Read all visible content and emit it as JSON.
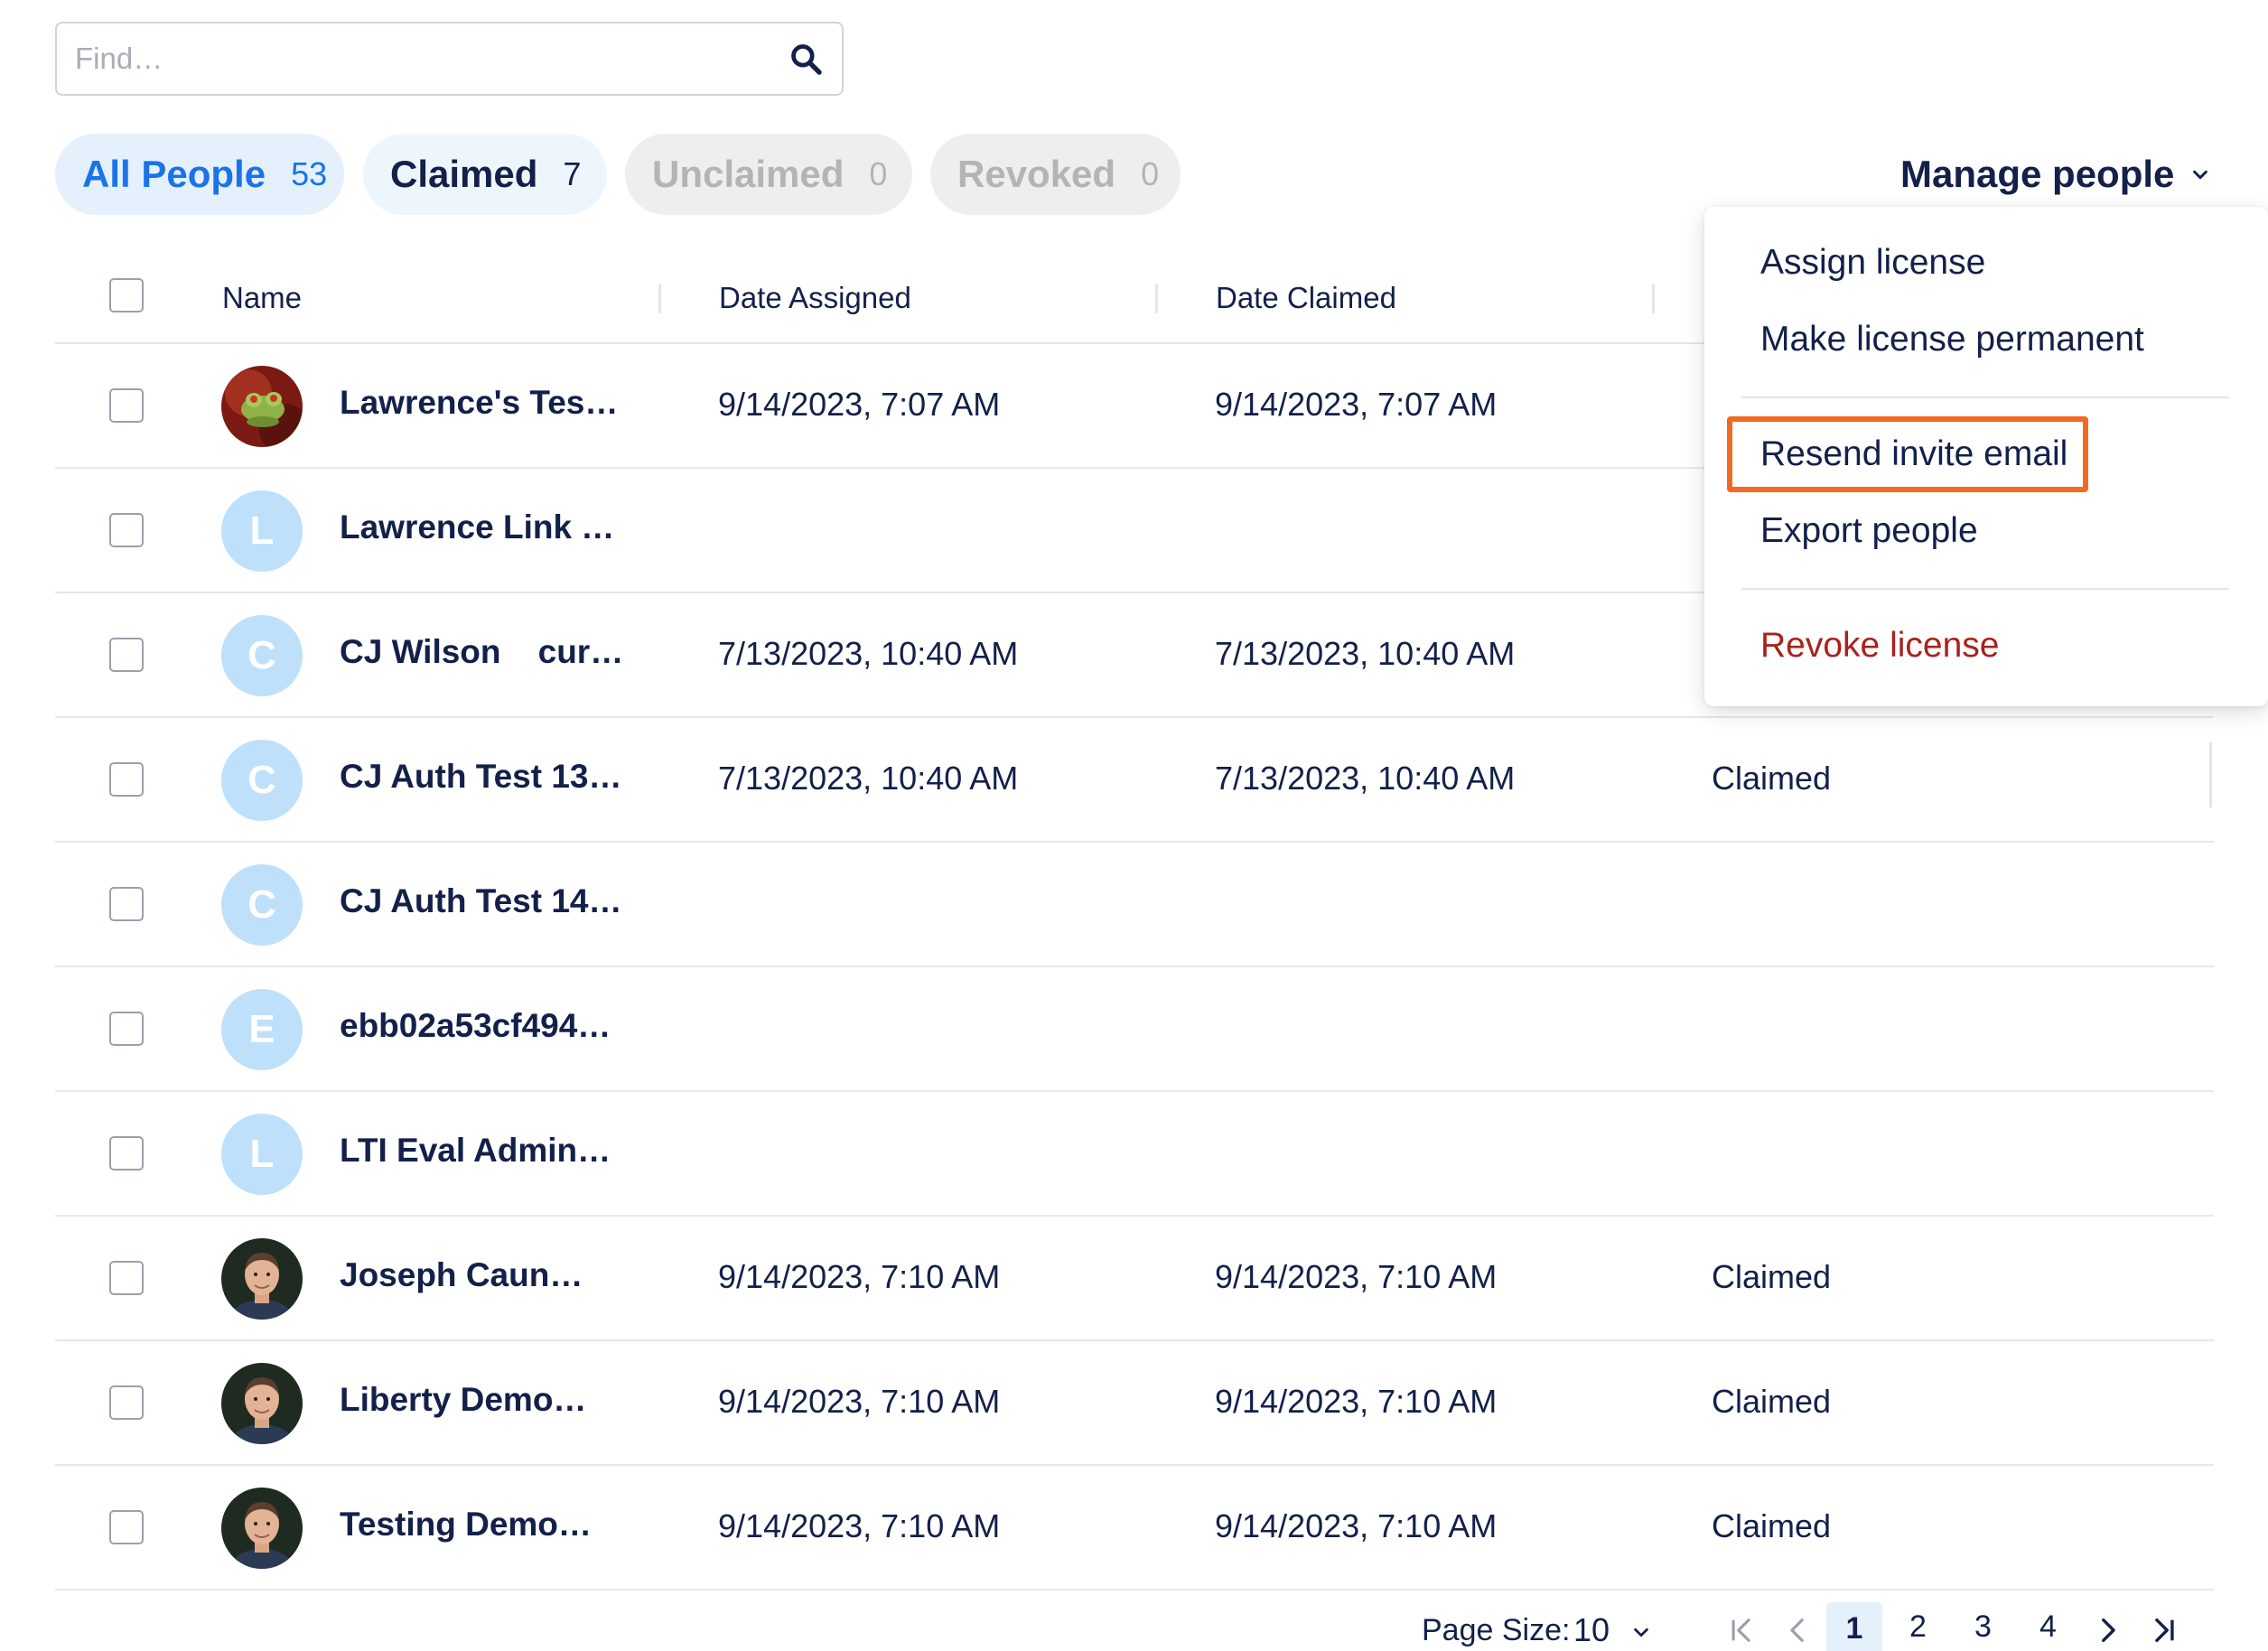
{
  "search": {
    "placeholder": "Find…"
  },
  "filters": [
    {
      "label": "All People",
      "count": "53"
    },
    {
      "label": "Claimed",
      "count": "7"
    },
    {
      "label": "Unclaimed",
      "count": "0"
    },
    {
      "label": "Revoked",
      "count": "0"
    }
  ],
  "manage": {
    "label": "Manage people"
  },
  "table": {
    "headers": {
      "name": "Name",
      "date_assigned": "Date Assigned",
      "date_claimed": "Date Claimed"
    },
    "rows": [
      {
        "name": "Lawrence's Tes…",
        "avatar": "photo-frog",
        "date_assigned": "9/14/2023, 7:07 AM",
        "date_claimed": "9/14/2023, 7:07 AM",
        "status": ""
      },
      {
        "name": "Lawrence Link …",
        "avatar": "L",
        "date_assigned": "",
        "date_claimed": "",
        "status": ""
      },
      {
        "name": "CJ Wilson    cur…",
        "avatar": "C",
        "date_assigned": "7/13/2023, 10:40 AM",
        "date_claimed": "7/13/2023, 10:40 AM",
        "status": ""
      },
      {
        "name": "CJ Auth Test 13…",
        "avatar": "C",
        "date_assigned": "7/13/2023, 10:40 AM",
        "date_claimed": "7/13/2023, 10:40 AM",
        "status": "Claimed"
      },
      {
        "name": "CJ Auth Test 14…",
        "avatar": "C",
        "date_assigned": "",
        "date_claimed": "",
        "status": ""
      },
      {
        "name": "ebb02a53cf494…",
        "avatar": "E",
        "date_assigned": "",
        "date_claimed": "",
        "status": ""
      },
      {
        "name": "LTI Eval Admin…",
        "avatar": "L",
        "date_assigned": "",
        "date_claimed": "",
        "status": ""
      },
      {
        "name": "Joseph Caun…",
        "avatar": "photo-man",
        "date_assigned": "9/14/2023, 7:10 AM",
        "date_claimed": "9/14/2023, 7:10 AM",
        "status": "Claimed"
      },
      {
        "name": "Liberty Demo…",
        "avatar": "photo-man",
        "date_assigned": "9/14/2023, 7:10 AM",
        "date_claimed": "9/14/2023, 7:10 AM",
        "status": "Claimed"
      },
      {
        "name": "Testing Demo…",
        "avatar": "photo-man",
        "date_assigned": "9/14/2023, 7:10 AM",
        "date_claimed": "9/14/2023, 7:10 AM",
        "status": "Claimed"
      }
    ]
  },
  "menu": {
    "assign": "Assign license",
    "permanent": "Make license permanent",
    "resend": "Resend invite email",
    "export": "Export people",
    "revoke": "Revoke license"
  },
  "pagination": {
    "page_size_label": "Page Size:",
    "page_size": "10",
    "pages": [
      "1",
      "2",
      "3",
      "4"
    ],
    "current": "1"
  },
  "colors": {
    "accent": "#1a73e8",
    "highlight": "#f26a22",
    "danger": "#a8221d",
    "avatar_bg": "#bfe0fb",
    "text": "#13204a"
  }
}
